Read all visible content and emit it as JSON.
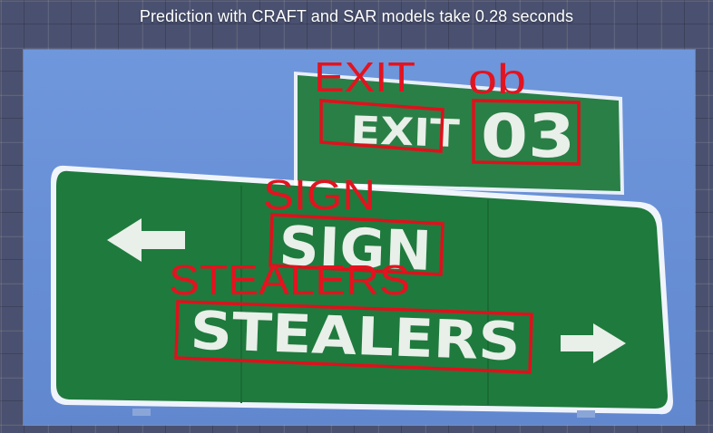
{
  "caption": "Prediction with CRAFT and SAR models take 0.28 seconds",
  "sign": {
    "top_words": [
      "EXIT",
      "03"
    ],
    "main_words": [
      "SIGN",
      "STEALERS"
    ]
  },
  "detections": [
    {
      "label": "EXIT"
    },
    {
      "label": "ob"
    },
    {
      "label": "SIGN"
    },
    {
      "label": "STEALERS"
    }
  ],
  "colors": {
    "box_color": "#e0101c",
    "sign_green": "#1f7a3d",
    "sky_blue": "#6c93d9"
  }
}
